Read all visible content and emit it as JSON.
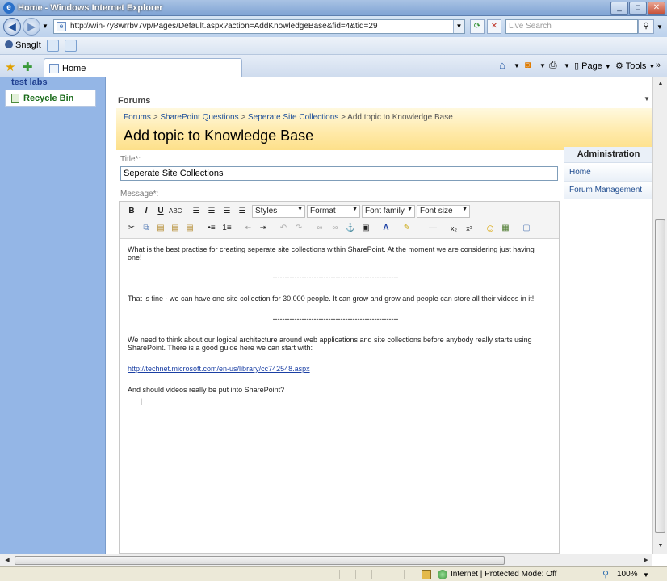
{
  "window": {
    "title": "Home - Windows Internet Explorer",
    "min": "_",
    "max": "□",
    "close": "✕"
  },
  "nav": {
    "url": "http://win-7y8wrrbv7vp/Pages/Default.aspx?action=AddKnowledgeBase&fid=4&tid=29",
    "search_placeholder": "Live Search"
  },
  "links_bar": {
    "snagit": "SnagIt"
  },
  "tab": {
    "label": "Home"
  },
  "commands": {
    "page": "Page",
    "tools": "Tools"
  },
  "left_nav": {
    "test_labs": "test labs",
    "recycle_bin": "Recycle Bin"
  },
  "main": {
    "section_header": "Forums",
    "breadcrumb": [
      "Forums",
      "SharePoint Questions",
      "Seperate Site Collections",
      "Add topic to Knowledge Base"
    ],
    "breadcrumb_sep": ">",
    "page_title": "Add topic to Knowledge Base",
    "title_label": "Title*:",
    "title_value": "Seperate Site Collections",
    "message_label": "Message*:"
  },
  "editor": {
    "styles": "Styles",
    "format": "Format",
    "font_family": "Font family",
    "font_size": "Font size",
    "para1": "What is the best practise for creating seperate site collections within SharePoint. At the moment we are considering just having one!",
    "sep": "----------------------------------------------------",
    "para2": "That is fine - we can have one site collection for 30,000 people. It can grow and grow and people can store all their videos in it!",
    "para3": "We need to think about our logical architecture around web applications and site collections before anybody really starts using SharePoint. There is a good guide here we can start with:",
    "link": "http://technet.microsoft.com/en-us/library/cc742548.aspx",
    "para4": "And should videos really be put into SharePoint?"
  },
  "admin": {
    "header": "Administration",
    "links": [
      "Home",
      "Forum Management"
    ]
  },
  "status": {
    "zone": "Internet | Protected Mode: Off",
    "zoom": "100%"
  }
}
